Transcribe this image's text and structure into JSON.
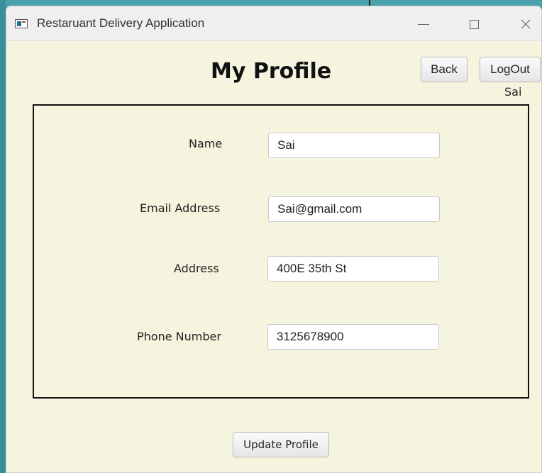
{
  "window": {
    "title": "Restaruant Delivery Application",
    "controls": {
      "minimize": "minimize-icon",
      "maximize": "maximize-icon",
      "close": "close-icon"
    }
  },
  "header": {
    "title": "My Profile",
    "back_label": "Back",
    "logout_label": "LogOut",
    "user_name": "Sai"
  },
  "form": {
    "name_label": "Name",
    "name_value": "Sai",
    "email_label": "Email Address",
    "email_value": "Sai@gmail.com",
    "address_label": "Address",
    "address_value": "400E 35th St",
    "phone_label": "Phone Number",
    "phone_value": "3125678900"
  },
  "footer": {
    "update_label": "Update Profile"
  },
  "colors": {
    "window_bg": "#f5f4de",
    "titlebar_bg": "#f0efef",
    "desktop_bg": "#2f8a96"
  }
}
